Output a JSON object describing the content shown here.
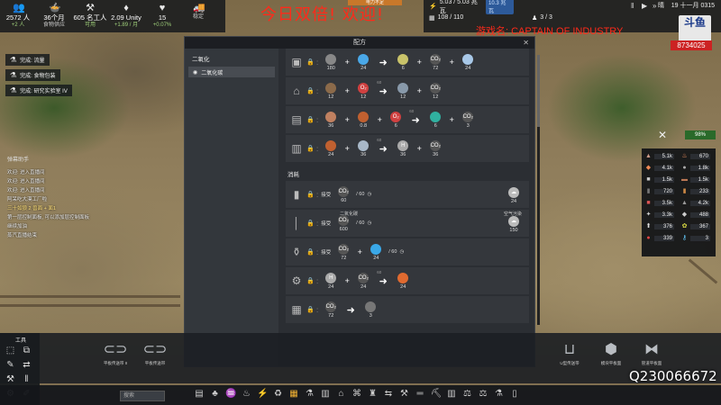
{
  "stream": {
    "title_overlay": "今日双倍! 欢迎!",
    "game_overlay": "游戏名: CAPTAIN OF INDUSTRY",
    "qq": "Q230066672",
    "platform_logo": "斗鱼",
    "room_number": "8734025"
  },
  "topbar": {
    "stats": [
      {
        "icon": "population-icon",
        "glyph": "👥",
        "value": "2572 人",
        "sub": "+2 人"
      },
      {
        "icon": "food-icon",
        "glyph": "🍲",
        "value": "36个月",
        "sub": "食物供应"
      },
      {
        "icon": "workers-icon",
        "glyph": "⚒",
        "value": "605 名工人",
        "sub": "可用"
      },
      {
        "icon": "unity-icon",
        "glyph": "♦",
        "value": "2.09 Unity",
        "sub": "+1.89 / 月"
      },
      {
        "icon": "health-icon",
        "glyph": "♥",
        "value": "15",
        "sub": "+0.07%"
      },
      {
        "icon": "vehicles-icon",
        "glyph": "🚚",
        "value": "",
        "sub": "稳定"
      }
    ],
    "warning": "电力不足",
    "power": "5.03 / 5.03 兆瓦",
    "power_badge": "10.3 兆瓦",
    "computing": "108 / 110",
    "workers_ratio": "3 / 3",
    "weather": "晴",
    "date": "19 十一月 0315"
  },
  "quests": [
    {
      "icon": "flask-icon",
      "label": "完成: 流量"
    },
    {
      "icon": "flask-icon",
      "label": "完成: 食物包装"
    },
    {
      "icon": "flask-icon",
      "label": "完成: 研究实验室 IV"
    }
  ],
  "chat": {
    "header": "弹幕助手",
    "lines": [
      {
        "text": "欢迎: 进入直播间",
        "hl": false
      },
      {
        "text": "欢迎: 进入直播间",
        "hl": false
      },
      {
        "text": "欢迎: 进入直播间",
        "hl": false
      },
      {
        "text": "阿呆吃大漠工厂啦",
        "hl": false
      },
      {
        "text": "三十如狼 2 兽面 + 面1",
        "hl": true
      },
      {
        "text": "第一层控制面板, 可以添加层控制面板",
        "hl": false
      },
      {
        "text": "继续加油",
        "hl": false
      },
      {
        "text": "蒸汽直播结束",
        "hl": false
      }
    ]
  },
  "right_panel": {
    "cells": [
      {
        "icon": "iron-ore-icon",
        "glyph": "▲",
        "value": "5.1k",
        "color": "#c98"
      },
      {
        "icon": "fuel-icon",
        "glyph": "♨",
        "value": "670",
        "color": "#f96"
      },
      {
        "icon": "food-icon",
        "glyph": "◆",
        "value": "4.1k",
        "color": "#e85"
      },
      {
        "icon": "water-icon",
        "glyph": "●",
        "value": "1.8k",
        "color": "#aaa"
      },
      {
        "icon": "glass-icon",
        "glyph": "■",
        "value": "1.5k",
        "color": "#ccc"
      },
      {
        "icon": "brick-icon",
        "glyph": "▬",
        "value": "1.5k",
        "color": "#b75"
      },
      {
        "icon": "steel-icon",
        "glyph": "▮",
        "value": "720",
        "color": "#777"
      },
      {
        "icon": "copper-icon",
        "glyph": "▮",
        "value": "233",
        "color": "#c84"
      },
      {
        "icon": "electronics-icon",
        "glyph": "■",
        "value": "3.5k",
        "color": "#d55"
      },
      {
        "icon": "plastic-icon",
        "glyph": "▲",
        "value": "4.2k",
        "color": "#999"
      },
      {
        "icon": "gears-icon",
        "glyph": "✦",
        "value": "3.3k",
        "color": "#ccc"
      },
      {
        "icon": "lab-icon",
        "glyph": "◆",
        "value": "488",
        "color": "#ccc"
      },
      {
        "icon": "diesel-icon",
        "glyph": "⬆",
        "value": "376",
        "color": "#ddd"
      },
      {
        "icon": "chem-icon",
        "glyph": "✿",
        "value": "367",
        "color": "#dd4"
      },
      {
        "icon": "barrel-icon",
        "glyph": "●",
        "value": "339",
        "color": "#d44"
      },
      {
        "icon": "key-icon",
        "glyph": "⚷",
        "value": "3",
        "color": "#6cf"
      }
    ],
    "tools_badge": "98%"
  },
  "dialog": {
    "title": "配方",
    "tab": "配方",
    "sidebar_category": "二氧化",
    "sidebar_item": "二氧化碳",
    "production": [
      {
        "machine": "boiler-icon",
        "inputs": [
          {
            "label": "",
            "n": "180",
            "color": "#888"
          },
          {
            "label": "",
            "n": "24",
            "color": "#4aa8e8"
          }
        ],
        "arrow": "",
        "outputs": [
          {
            "label": "",
            "n": "6",
            "color": "#c9c36a"
          },
          {
            "label": "CO₂",
            "n": "72",
            "color": "#555"
          },
          {
            "label": "",
            "n": "24",
            "color": "#a8c8e8"
          }
        ]
      },
      {
        "machine": "furnace-icon",
        "inputs": [
          {
            "label": "",
            "n": "12",
            "color": "#8b6a4a"
          },
          {
            "label": "O₂",
            "n": "12",
            "color": "#d04040"
          }
        ],
        "arrow": "60",
        "outputs": [
          {
            "label": "",
            "n": "12",
            "color": "#8899aa"
          },
          {
            "label": "CO₂",
            "n": "12",
            "color": "#555"
          }
        ]
      },
      {
        "machine": "reformer-icon",
        "inputs": [
          {
            "label": "",
            "n": "36",
            "color": "#c08060"
          },
          {
            "label": "",
            "n": "0.8",
            "color": "#c06030"
          },
          {
            "label": "O₂",
            "n": "6",
            "color": "#d04040"
          }
        ],
        "arrow": "60",
        "outputs": [
          {
            "label": "",
            "n": "6",
            "color": "#30b0a0"
          },
          {
            "label": "CO₂",
            "n": "3",
            "color": "#555"
          }
        ]
      },
      {
        "machine": "synthesis-icon",
        "inputs": [
          {
            "label": "",
            "n": "24",
            "color": "#c06030"
          },
          {
            "label": "",
            "n": "36",
            "color": "#a8b8c8"
          }
        ],
        "arrow": "60",
        "outputs": [
          {
            "label": "H",
            "n": "36",
            "color": "#aaa"
          },
          {
            "label": "CO₂",
            "n": "36",
            "color": "#555"
          }
        ]
      }
    ],
    "consumption_title": "消耗",
    "consumption": [
      {
        "machine": "chimney-icon",
        "sub": "",
        "action": "接受",
        "inputs": [
          {
            "label": "CO₂",
            "n": "60",
            "color": "#555"
          }
        ],
        "rate": "/ 60",
        "outputs": [],
        "sub_right": "",
        "right_n": "24"
      },
      {
        "machine": "exhaust-icon",
        "sub": "二氧化碳",
        "action": "接受",
        "inputs": [
          {
            "label": "CO₂",
            "n": "600",
            "color": "#555"
          }
        ],
        "rate": "/ 60",
        "outputs": [],
        "sub_right": "空气污染",
        "right_n": "150"
      },
      {
        "machine": "filter-icon",
        "sub": "",
        "action": "接受",
        "inputs": [
          {
            "label": "CO₂",
            "n": "72",
            "color": "#555"
          },
          {
            "label": "",
            "n": "24",
            "color": "#3aa8e8"
          }
        ],
        "rate": "/ 60",
        "outputs": [],
        "sub_right": "",
        "right_n": ""
      },
      {
        "machine": "reactor-icon",
        "sub": "",
        "action": "",
        "inputs": [
          {
            "label": "H",
            "n": "24",
            "color": "#aaa"
          },
          {
            "label": "CO₂",
            "n": "24",
            "color": "#555"
          }
        ],
        "rate": "60",
        "outputs": [
          {
            "label": "",
            "n": "24",
            "color": "#e06a30"
          }
        ],
        "sub_right": "",
        "right_n": ""
      },
      {
        "machine": "storage-icon",
        "sub": "",
        "action": "",
        "inputs": [
          {
            "label": "CO₂",
            "n": "72",
            "color": "#555"
          }
        ],
        "rate": "",
        "outputs": [
          {
            "label": "",
            "n": "3",
            "color": "#777"
          }
        ],
        "sub_right": "",
        "right_n": ""
      }
    ]
  },
  "tools": {
    "label": "工具"
  },
  "build_items": [
    {
      "label": "平板传送带 II",
      "icon": "conveyor-icon"
    },
    {
      "label": "平板传送带",
      "icon": "conveyor-icon"
    },
    {
      "label": "U型传送带",
      "icon": "u-conveyor-icon"
    },
    {
      "label": "模块平板面",
      "icon": "module-icon"
    },
    {
      "label": "管道平板面",
      "icon": "pipe-icon"
    }
  ],
  "search_placeholder": "搜索"
}
